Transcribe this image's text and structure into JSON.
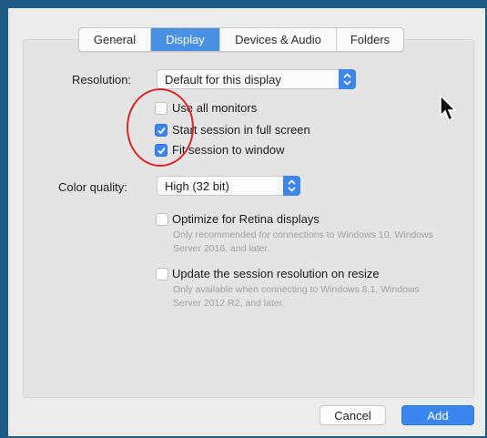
{
  "tabs": [
    {
      "label": "General",
      "active": false
    },
    {
      "label": "Display",
      "active": true
    },
    {
      "label": "Devices & Audio",
      "active": false
    },
    {
      "label": "Folders",
      "active": false
    }
  ],
  "resolution": {
    "label": "Resolution:",
    "value": "Default for this display"
  },
  "checkboxes": [
    {
      "label": "Use all monitors",
      "checked": false
    },
    {
      "label": "Start session in full screen",
      "checked": true
    },
    {
      "label": "Fit session to window",
      "checked": true
    }
  ],
  "color_quality": {
    "label": "Color quality:",
    "value": "High (32 bit)"
  },
  "retina": {
    "label": "Optimize for Retina displays",
    "checked": false,
    "description": "Only recommended for connections to Windows 10, Windows Server 2016, and later."
  },
  "resize": {
    "label": "Update the session resolution on resize",
    "checked": false,
    "description": "Only available when connecting to Windows 8.1, Windows Server 2012 R2, and later."
  },
  "buttons": {
    "cancel": "Cancel",
    "add": "Add"
  },
  "colors": {
    "accent": "#3d86ea",
    "annotation": "#e0242b",
    "frame": "#1f5a86"
  }
}
